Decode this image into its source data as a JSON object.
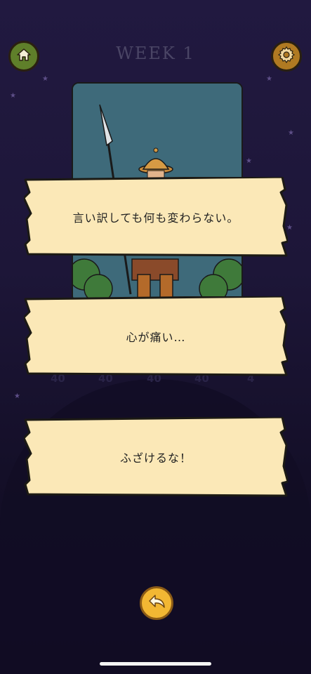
{
  "header": {
    "title": "WEEK 1"
  },
  "icons": {
    "home": "home-icon",
    "settings": "gear-icon",
    "back": "undo-arrow-icon"
  },
  "scores": [
    "40",
    "40",
    "40",
    "40",
    "4"
  ],
  "choices": [
    {
      "label": "言い訳しても何も変わらない。"
    },
    {
      "label": "心が痛い…"
    },
    {
      "label": "ふざけるな！"
    }
  ],
  "colors": {
    "parchment": "#fbe8b7",
    "accent": "#f2b733",
    "background": "#1d1638"
  }
}
